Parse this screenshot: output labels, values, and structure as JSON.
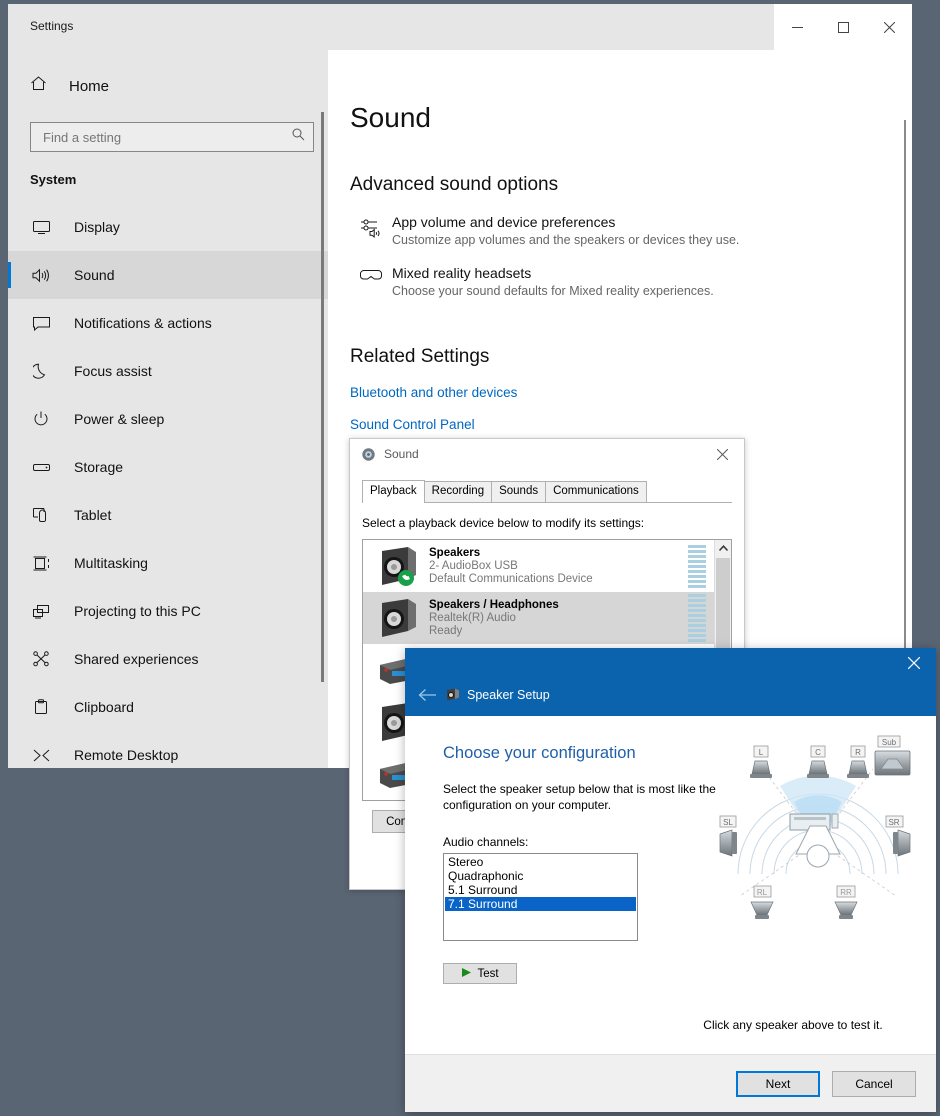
{
  "settings_window": {
    "title": "Settings",
    "window_buttons": [
      {
        "name": "minimize",
        "glyph": "—"
      },
      {
        "name": "maximize",
        "glyph": "□"
      },
      {
        "name": "close",
        "glyph": "✕"
      }
    ],
    "home": {
      "label": "Home",
      "icon": "home-icon"
    },
    "search": {
      "value": "",
      "placeholder": "Find a setting",
      "icon": "search-icon"
    },
    "section_header": "System",
    "nav_items": [
      {
        "label": "Display",
        "icon": "monitor-icon",
        "selected": false
      },
      {
        "label": "Sound",
        "icon": "volume-icon",
        "selected": true
      },
      {
        "label": "Notifications & actions",
        "icon": "chat-icon",
        "selected": false
      },
      {
        "label": "Focus assist",
        "icon": "moon-icon",
        "selected": false
      },
      {
        "label": "Power & sleep",
        "icon": "power-icon",
        "selected": false
      },
      {
        "label": "Storage",
        "icon": "drive-icon",
        "selected": false
      },
      {
        "label": "Tablet",
        "icon": "tablet-icon",
        "selected": false
      },
      {
        "label": "Multitasking",
        "icon": "multitask-icon",
        "selected": false
      },
      {
        "label": "Projecting to this PC",
        "icon": "project-icon",
        "selected": false
      },
      {
        "label": "Shared experiences",
        "icon": "share-icon",
        "selected": false
      },
      {
        "label": "Clipboard",
        "icon": "clipboard-icon",
        "selected": false
      },
      {
        "label": "Remote Desktop",
        "icon": "remote-desktop-icon",
        "selected": false
      }
    ],
    "main": {
      "page_title": "Sound",
      "advanced_header": "Advanced sound options",
      "advanced_items": [
        {
          "title": "App volume and device preferences",
          "subtitle": "Customize app volumes and the speakers or devices they use.",
          "icon": "sliders-volume-icon"
        },
        {
          "title": "Mixed reality headsets",
          "subtitle": "Choose your sound defaults for Mixed reality experiences.",
          "icon": "vr-headset-icon"
        }
      ],
      "related_header": "Related Settings",
      "related_links": [
        "Bluetooth and other devices",
        "Sound Control Panel"
      ]
    }
  },
  "sound_dialog": {
    "title": "Sound",
    "icon": "sound-speaker-icon",
    "close_glyph": "✕",
    "tabs": [
      {
        "label": "Playback",
        "active": true
      },
      {
        "label": "Recording",
        "active": false
      },
      {
        "label": "Sounds",
        "active": false
      },
      {
        "label": "Communications",
        "active": false
      }
    ],
    "instruction": "Select a playback device below to modify its settings:",
    "devices": [
      {
        "name": "Speakers",
        "line2": "2- AudioBox USB",
        "line3": "Default Communications Device",
        "selected": false,
        "badge": "communications-badge",
        "vu_level": 9
      },
      {
        "name": "Speakers / Headphones",
        "line2": "Realtek(R) Audio",
        "line3": "Ready",
        "selected": true,
        "badge": "",
        "vu_level": 10
      }
    ],
    "configure_button": "Configure",
    "scroll_up_glyph": "⌃"
  },
  "speaker_setup": {
    "title": "Speaker Setup",
    "icon": "speaker-setup-icon",
    "back_glyph": "←",
    "close_glyph": "✕",
    "heading": "Choose your configuration",
    "description": "Select the speaker setup below that is most like the configuration on your computer.",
    "channels_label": "Audio channels:",
    "channel_options": [
      {
        "label": "Stereo",
        "selected": false
      },
      {
        "label": "Quadraphonic",
        "selected": false
      },
      {
        "label": "5.1 Surround",
        "selected": false
      },
      {
        "label": "7.1 Surround",
        "selected": true
      }
    ],
    "test_button": "Test",
    "diagram_hint": "Click any speaker above to test it.",
    "diagram_speakers": [
      {
        "label": "L",
        "position": "front-left"
      },
      {
        "label": "C",
        "position": "front-center"
      },
      {
        "label": "R",
        "position": "front-right"
      },
      {
        "label": "Sub",
        "position": "subwoofer"
      },
      {
        "label": "SL",
        "position": "side-left"
      },
      {
        "label": "SR",
        "position": "side-right"
      },
      {
        "label": "RL",
        "position": "rear-left"
      },
      {
        "label": "RR",
        "position": "rear-right"
      }
    ],
    "next_button": "Next",
    "cancel_button": "Cancel"
  },
  "colors": {
    "desktop": "#5a6573",
    "accent_blue": "#0078d7",
    "link_blue": "#0067c0",
    "wizard_title_blue": "#0b62ad",
    "selection_blue": "#0a64c8",
    "sidebar_gray": "#e6e6e6"
  }
}
